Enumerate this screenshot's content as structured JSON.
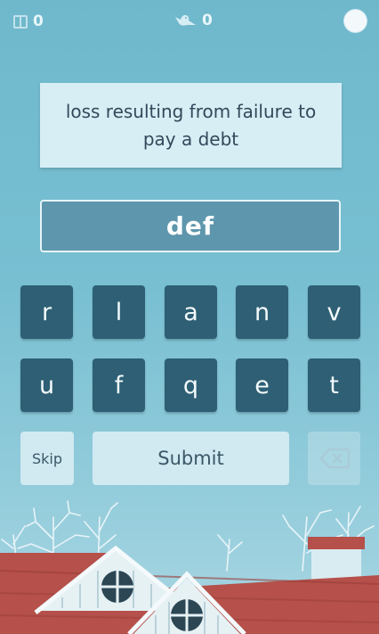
{
  "header": {
    "score": "0",
    "streak": "0",
    "icons": [
      "book-icon",
      "bird-icon",
      "timer-icon"
    ]
  },
  "clue": {
    "text": "loss resulting from failure to pay a debt"
  },
  "answer": {
    "text": "def"
  },
  "letters": {
    "row1": [
      "r",
      "l",
      "a",
      "n",
      "v"
    ],
    "row2": [
      "u",
      "f",
      "q",
      "e",
      "t"
    ]
  },
  "controls": {
    "skip_label": "Skip",
    "submit_label": "Submit",
    "delete_icon": "backspace-icon"
  },
  "colors": {
    "sky": "#78bfd2",
    "tile": "#2e5f74",
    "answer_box": "#5e97ad",
    "clue_box": "#d7eef5",
    "roof": "#b5504a"
  }
}
